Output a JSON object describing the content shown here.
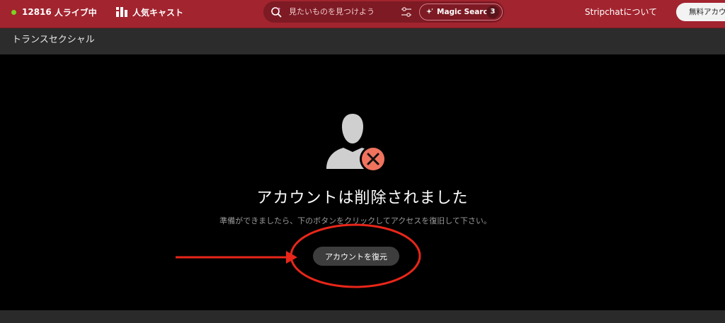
{
  "header": {
    "live_count": "12816",
    "live_label": "人ライブ中",
    "popular_label": "人気キャスト",
    "search_placeholder": "見たいものを見つけよう",
    "magic_label": "Magic Search",
    "magic_badge": "3",
    "about_label": "Stripchatについて",
    "signup_label": "無料アカウ"
  },
  "category": {
    "title": "トランスセクシャル"
  },
  "main": {
    "title": "アカウントは削除されました",
    "subtitle": "準備ができましたら、下のボタンをクリックしてアクセスを復旧して下さい。",
    "button_label": "アカウントを復元"
  },
  "colors": {
    "header_bg": "#a2242f",
    "live_dot": "#7ed321",
    "annotation_red": "#e8261a",
    "delete_badge": "#f0735e"
  },
  "icons": {
    "live": "live-dot-icon",
    "popular": "bar-chart-icon",
    "search": "search-sparkle-icon",
    "filter": "filter-sliders-icon",
    "magic": "sparkle-icon",
    "avatar": "user-deleted-icon"
  }
}
